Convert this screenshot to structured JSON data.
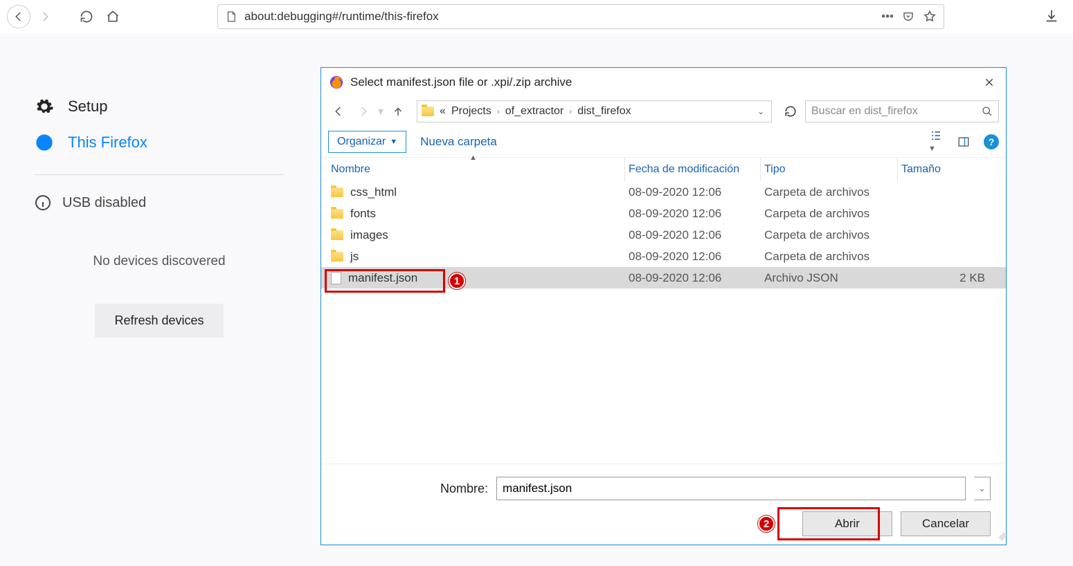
{
  "toolbar": {
    "url": "about:debugging#/runtime/this-firefox"
  },
  "sidebar": {
    "setup": "Setup",
    "this_firefox": "This Firefox",
    "usb_disabled": "USB disabled",
    "no_devices": "No devices discovered",
    "refresh": "Refresh devices"
  },
  "dialog": {
    "title": "Select manifest.json file or .xpi/.zip archive",
    "breadcrumb": {
      "sep": "«",
      "p1": "Projects",
      "p2": "of_extractor",
      "p3": "dist_firefox"
    },
    "search_placeholder": "Buscar en dist_firefox",
    "organize": "Organizar",
    "new_folder": "Nueva carpeta",
    "columns": {
      "name": "Nombre",
      "date": "Fecha de modificación",
      "type": "Tipo",
      "size": "Tamaño"
    },
    "files": [
      {
        "name": "css_html",
        "date": "08-09-2020 12:06",
        "type": "Carpeta de archivos",
        "size": "",
        "kind": "folder",
        "selected": false
      },
      {
        "name": "fonts",
        "date": "08-09-2020 12:06",
        "type": "Carpeta de archivos",
        "size": "",
        "kind": "folder",
        "selected": false
      },
      {
        "name": "images",
        "date": "08-09-2020 12:06",
        "type": "Carpeta de archivos",
        "size": "",
        "kind": "folder",
        "selected": false
      },
      {
        "name": "js",
        "date": "08-09-2020 12:06",
        "type": "Carpeta de archivos",
        "size": "",
        "kind": "folder",
        "selected": false
      },
      {
        "name": "manifest.json",
        "date": "08-09-2020 12:06",
        "type": "Archivo JSON",
        "size": "2 KB",
        "kind": "file",
        "selected": true
      }
    ],
    "name_label": "Nombre:",
    "name_value": "manifest.json",
    "open": "Abrir",
    "cancel": "Cancelar"
  },
  "callouts": {
    "one": "1",
    "two": "2"
  }
}
